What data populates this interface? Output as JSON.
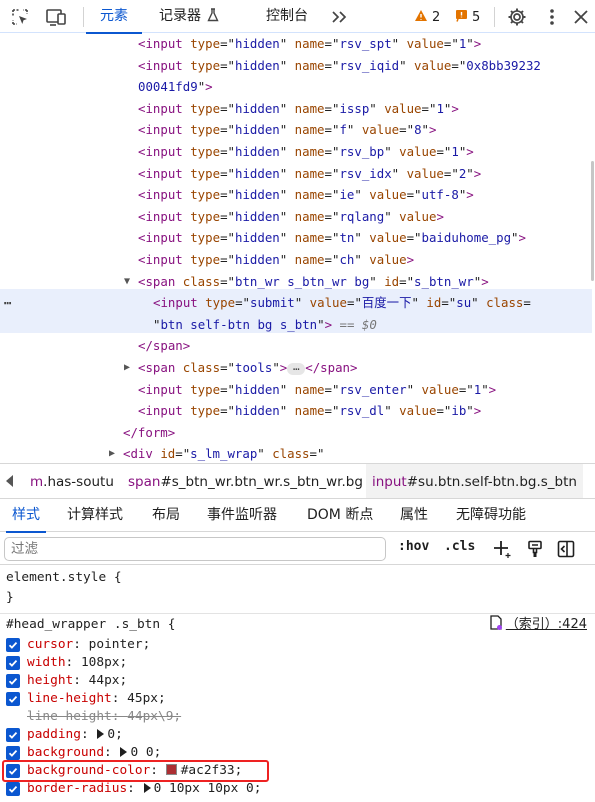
{
  "toolbar": {
    "tabs": [
      {
        "label": "元素"
      },
      {
        "label": "记录器"
      },
      {
        "label": "控制台"
      }
    ],
    "warnings_count": "2",
    "issues_count": "5",
    "colors": {
      "accent": "#0b57d0",
      "warning": "#e37400",
      "issue": "#e37400"
    }
  },
  "elements": {
    "lines": [
      {
        "parts": [
          [
            "tag",
            "<input "
          ],
          [
            "attr",
            "type"
          ],
          [
            "eq",
            "=\""
          ],
          [
            "val",
            "hidden"
          ],
          [
            "eq",
            "\" "
          ],
          [
            "attr",
            "name"
          ],
          [
            "eq",
            "=\""
          ],
          [
            "val",
            "rsv_spt"
          ],
          [
            "eq",
            "\" "
          ],
          [
            "attr",
            "value"
          ],
          [
            "eq",
            "=\""
          ],
          [
            "val",
            "1"
          ],
          [
            "eq",
            "\""
          ],
          [
            "tag",
            ">"
          ]
        ]
      },
      {
        "parts": [
          [
            "tag",
            "<input "
          ],
          [
            "attr",
            "type"
          ],
          [
            "eq",
            "=\""
          ],
          [
            "val",
            "hidden"
          ],
          [
            "eq",
            "\" "
          ],
          [
            "attr",
            "name"
          ],
          [
            "eq",
            "=\""
          ],
          [
            "val",
            "rsv_iqid"
          ],
          [
            "eq",
            "\" "
          ],
          [
            "attr",
            "value"
          ],
          [
            "eq",
            "=\""
          ],
          [
            "val",
            "0x8bb39232"
          ]
        ]
      },
      {
        "parts": [
          [
            "val",
            "00041fd9"
          ],
          [
            "eq",
            "\""
          ],
          [
            "tag",
            ">"
          ]
        ]
      },
      {
        "parts": [
          [
            "tag",
            "<input "
          ],
          [
            "attr",
            "type"
          ],
          [
            "eq",
            "=\""
          ],
          [
            "val",
            "hidden"
          ],
          [
            "eq",
            "\" "
          ],
          [
            "attr",
            "name"
          ],
          [
            "eq",
            "=\""
          ],
          [
            "val",
            "issp"
          ],
          [
            "eq",
            "\" "
          ],
          [
            "attr",
            "value"
          ],
          [
            "eq",
            "=\""
          ],
          [
            "val",
            "1"
          ],
          [
            "eq",
            "\""
          ],
          [
            "tag",
            ">"
          ]
        ]
      },
      {
        "parts": [
          [
            "tag",
            "<input "
          ],
          [
            "attr",
            "type"
          ],
          [
            "eq",
            "=\""
          ],
          [
            "val",
            "hidden"
          ],
          [
            "eq",
            "\" "
          ],
          [
            "attr",
            "name"
          ],
          [
            "eq",
            "=\""
          ],
          [
            "val",
            "f"
          ],
          [
            "eq",
            "\" "
          ],
          [
            "attr",
            "value"
          ],
          [
            "eq",
            "=\""
          ],
          [
            "val",
            "8"
          ],
          [
            "eq",
            "\""
          ],
          [
            "tag",
            ">"
          ]
        ]
      },
      {
        "parts": [
          [
            "tag",
            "<input "
          ],
          [
            "attr",
            "type"
          ],
          [
            "eq",
            "=\""
          ],
          [
            "val",
            "hidden"
          ],
          [
            "eq",
            "\" "
          ],
          [
            "attr",
            "name"
          ],
          [
            "eq",
            "=\""
          ],
          [
            "val",
            "rsv_bp"
          ],
          [
            "eq",
            "\" "
          ],
          [
            "attr",
            "value"
          ],
          [
            "eq",
            "=\""
          ],
          [
            "val",
            "1"
          ],
          [
            "eq",
            "\""
          ],
          [
            "tag",
            ">"
          ]
        ]
      },
      {
        "parts": [
          [
            "tag",
            "<input "
          ],
          [
            "attr",
            "type"
          ],
          [
            "eq",
            "=\""
          ],
          [
            "val",
            "hidden"
          ],
          [
            "eq",
            "\" "
          ],
          [
            "attr",
            "name"
          ],
          [
            "eq",
            "=\""
          ],
          [
            "val",
            "rsv_idx"
          ],
          [
            "eq",
            "\" "
          ],
          [
            "attr",
            "value"
          ],
          [
            "eq",
            "=\""
          ],
          [
            "val",
            "2"
          ],
          [
            "eq",
            "\""
          ],
          [
            "tag",
            ">"
          ]
        ]
      },
      {
        "parts": [
          [
            "tag",
            "<input "
          ],
          [
            "attr",
            "type"
          ],
          [
            "eq",
            "=\""
          ],
          [
            "val",
            "hidden"
          ],
          [
            "eq",
            "\" "
          ],
          [
            "attr",
            "name"
          ],
          [
            "eq",
            "=\""
          ],
          [
            "val",
            "ie"
          ],
          [
            "eq",
            "\" "
          ],
          [
            "attr",
            "value"
          ],
          [
            "eq",
            "=\""
          ],
          [
            "val",
            "utf-8"
          ],
          [
            "eq",
            "\""
          ],
          [
            "tag",
            ">"
          ]
        ]
      },
      {
        "parts": [
          [
            "tag",
            "<input "
          ],
          [
            "attr",
            "type"
          ],
          [
            "eq",
            "=\""
          ],
          [
            "val",
            "hidden"
          ],
          [
            "eq",
            "\" "
          ],
          [
            "attr",
            "name"
          ],
          [
            "eq",
            "=\""
          ],
          [
            "val",
            "rqlang"
          ],
          [
            "eq",
            "\" "
          ],
          [
            "attr",
            "value"
          ],
          [
            "tag",
            ">"
          ]
        ]
      },
      {
        "parts": [
          [
            "tag",
            "<input "
          ],
          [
            "attr",
            "type"
          ],
          [
            "eq",
            "=\""
          ],
          [
            "val",
            "hidden"
          ],
          [
            "eq",
            "\" "
          ],
          [
            "attr",
            "name"
          ],
          [
            "eq",
            "=\""
          ],
          [
            "val",
            "tn"
          ],
          [
            "eq",
            "\" "
          ],
          [
            "attr",
            "value"
          ],
          [
            "eq",
            "=\""
          ],
          [
            "val",
            "baiduhome_pg"
          ],
          [
            "eq",
            "\""
          ],
          [
            "tag",
            ">"
          ]
        ]
      },
      {
        "parts": [
          [
            "tag",
            "<input "
          ],
          [
            "attr",
            "type"
          ],
          [
            "eq",
            "=\""
          ],
          [
            "val",
            "hidden"
          ],
          [
            "eq",
            "\" "
          ],
          [
            "attr",
            "name"
          ],
          [
            "eq",
            "=\""
          ],
          [
            "val",
            "ch"
          ],
          [
            "eq",
            "\" "
          ],
          [
            "attr",
            "value"
          ],
          [
            "tag",
            ">"
          ]
        ]
      },
      {
        "parts": [
          [
            "tag",
            "<span "
          ],
          [
            "attr",
            "class"
          ],
          [
            "eq",
            "=\""
          ],
          [
            "val",
            "btn_wr s_btn_wr bg"
          ],
          [
            "eq",
            "\" "
          ],
          [
            "attr",
            "id"
          ],
          [
            "eq",
            "=\""
          ],
          [
            "val",
            "s_btn_wr"
          ],
          [
            "eq",
            "\""
          ],
          [
            "tag",
            ">"
          ]
        ]
      },
      {
        "parts": [
          [
            "tag",
            "<input "
          ],
          [
            "attr",
            "type"
          ],
          [
            "eq",
            "=\""
          ],
          [
            "val",
            "submit"
          ],
          [
            "eq",
            "\" "
          ],
          [
            "attr",
            "value"
          ],
          [
            "eq",
            "=\""
          ],
          [
            "val",
            "百度一下"
          ],
          [
            "eq",
            "\" "
          ],
          [
            "attr",
            "id"
          ],
          [
            "eq",
            "=\""
          ],
          [
            "val",
            "su"
          ],
          [
            "eq",
            "\" "
          ],
          [
            "attr",
            "class"
          ],
          [
            "eq",
            "="
          ]
        ]
      },
      {
        "parts": [
          [
            "eq",
            "\""
          ],
          [
            "val",
            "btn self-btn bg s_btn"
          ],
          [
            "eq",
            "\""
          ],
          [
            "tag",
            ">"
          ],
          [
            "dim",
            " == $0"
          ]
        ]
      },
      {
        "parts": [
          [
            "tag",
            "</span>"
          ]
        ]
      },
      {
        "parts": [
          [
            "tag",
            "<span "
          ],
          [
            "attr",
            "class"
          ],
          [
            "eq",
            "=\""
          ],
          [
            "val",
            "tools"
          ],
          [
            "eq",
            "\""
          ],
          [
            "tag",
            ">"
          ],
          [
            "pill",
            "…"
          ],
          [
            "tag",
            "</span>"
          ]
        ]
      },
      {
        "parts": [
          [
            "tag",
            "<input "
          ],
          [
            "attr",
            "type"
          ],
          [
            "eq",
            "=\""
          ],
          [
            "val",
            "hidden"
          ],
          [
            "eq",
            "\" "
          ],
          [
            "attr",
            "name"
          ],
          [
            "eq",
            "=\""
          ],
          [
            "val",
            "rsv_enter"
          ],
          [
            "eq",
            "\" "
          ],
          [
            "attr",
            "value"
          ],
          [
            "eq",
            "=\""
          ],
          [
            "val",
            "1"
          ],
          [
            "eq",
            "\""
          ],
          [
            "tag",
            ">"
          ]
        ]
      },
      {
        "parts": [
          [
            "tag",
            "<input "
          ],
          [
            "attr",
            "type"
          ],
          [
            "eq",
            "=\""
          ],
          [
            "val",
            "hidden"
          ],
          [
            "eq",
            "\" "
          ],
          [
            "attr",
            "name"
          ],
          [
            "eq",
            "=\""
          ],
          [
            "val",
            "rsv_dl"
          ],
          [
            "eq",
            "\" "
          ],
          [
            "attr",
            "value"
          ],
          [
            "eq",
            "=\""
          ],
          [
            "val",
            "ib"
          ],
          [
            "eq",
            "\""
          ],
          [
            "tag",
            ">"
          ]
        ]
      },
      {
        "parts": [
          [
            "tag",
            "</form>"
          ]
        ]
      },
      {
        "parts": [
          [
            "tag",
            "<div "
          ],
          [
            "attr",
            "id"
          ],
          [
            "eq",
            "=\""
          ],
          [
            "val",
            "s_lm_wrap"
          ],
          [
            "eq",
            "\" "
          ],
          [
            "attr",
            "class"
          ],
          [
            "eq",
            "=\""
          ]
        ]
      }
    ]
  },
  "breadcrumbs": [
    {
      "tag": "m",
      "rest": ".has-soutu"
    },
    {
      "tag": "span",
      "rest": "#s_btn_wr.btn_wr.s_btn_wr.bg"
    },
    {
      "tag": "input",
      "rest": "#su.btn.self-btn.bg.s_btn"
    }
  ],
  "subtabs": [
    "样式",
    "计算样式",
    "布局",
    "事件监听器",
    "DOM 断点",
    "属性",
    "无障碍功能"
  ],
  "filter": {
    "placeholder": "过滤",
    "hov": ":hov",
    "cls": ".cls"
  },
  "styles": {
    "element_style": {
      "selector": "element.style {",
      "close": "}"
    },
    "rule": {
      "selector": "#head_wrapper .s_btn {",
      "source": "（索引）:424",
      "declarations": [
        {
          "prop": "cursor",
          "value": "pointer;",
          "checked": true
        },
        {
          "prop": "width",
          "value": "108px;",
          "checked": true
        },
        {
          "prop": "height",
          "value": "44px;",
          "checked": true
        },
        {
          "prop": "line-height",
          "value": "45px;",
          "checked": true
        },
        {
          "prop": "line-height",
          "value": "44px\\9;",
          "checked": false,
          "overridden": true
        },
        {
          "prop": "padding",
          "value": "0;",
          "checked": true,
          "expandable": true
        },
        {
          "prop": "background",
          "value": "0 0;",
          "checked": true,
          "expandable": true
        },
        {
          "prop": "background-color",
          "value": "#ac2f33;",
          "checked": true,
          "swatch": "#ac2f33"
        },
        {
          "prop": "border-radius",
          "value": "0 10px 10px 0;",
          "checked": true,
          "expandable": true
        }
      ]
    }
  }
}
